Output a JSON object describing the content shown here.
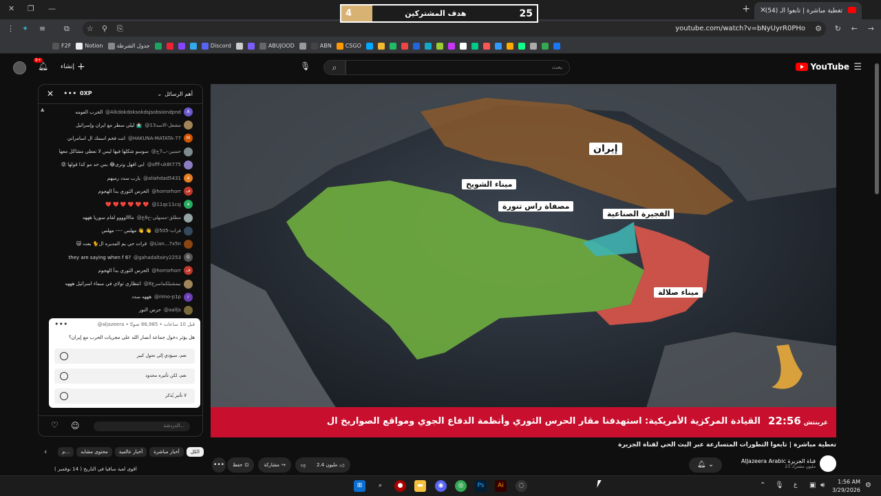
{
  "browser": {
    "tab_title": "(54) تغطية مباشرة | تابعوا الـ",
    "url": "youtube.com/watch?v=bNyUyrR0PHo",
    "bookmarks": [
      {
        "label": "F2F",
        "color": "#555"
      },
      {
        "label": "Notion",
        "color": "#eee"
      },
      {
        "label": "جدول الشرطة",
        "color": "#888"
      },
      {
        "label": "",
        "color": "#1da462"
      },
      {
        "label": "",
        "color": "#e23"
      },
      {
        "label": "",
        "color": "#8844ff"
      },
      {
        "label": "",
        "color": "#3ae"
      },
      {
        "label": "Discord",
        "color": "#5865f2"
      },
      {
        "label": "",
        "color": "#ccc"
      },
      {
        "label": "",
        "color": "#7b5cff"
      },
      {
        "label": "ABUJOOD",
        "color": "#666"
      },
      {
        "label": "",
        "color": "#999"
      },
      {
        "label": "ABN",
        "color": "#444"
      },
      {
        "label": "CSGO",
        "color": "#f90"
      },
      {
        "label": "",
        "color": "#0af"
      },
      {
        "label": "",
        "color": "#f3ba2f"
      },
      {
        "label": "",
        "color": "#2b6"
      },
      {
        "label": "",
        "color": "#e44"
      },
      {
        "label": "",
        "color": "#26d"
      },
      {
        "label": "",
        "color": "#1ac"
      },
      {
        "label": "",
        "color": "#9c3"
      },
      {
        "label": "",
        "color": "#c3f"
      },
      {
        "label": "",
        "color": "#fff"
      },
      {
        "label": "",
        "color": "#0c8"
      },
      {
        "label": "",
        "color": "#f55"
      },
      {
        "label": "",
        "color": "#39f"
      },
      {
        "label": "",
        "color": "#fa0"
      },
      {
        "label": "",
        "color": "#1f8"
      },
      {
        "label": "",
        "color": "#aaa"
      },
      {
        "label": "",
        "color": "#34a853"
      },
      {
        "label": "",
        "color": "#1877f2"
      }
    ]
  },
  "goal_overlay": {
    "label": "هدف المشتركين",
    "current": "4",
    "target": "25",
    "progress": 0.16,
    "fill_color": "#d8b272"
  },
  "youtube": {
    "logo_text": "YouTube",
    "search_placeholder": "بحث",
    "create_label": "إنشاء",
    "notification_count": "9+"
  },
  "chat": {
    "header_title": "أهم الرسائل",
    "points": "0XP",
    "messages": [
      {
        "author": "@Alkdokdoksokdsjsobsiondpnd",
        "text": "الحرب العومه",
        "avatar_color": "#6a5acd",
        "avatar_letter": "A"
      },
      {
        "author": "@مشعل-الاسد13",
        "text": "ليلي سطر مع ايران وإسرائيل 🤷🏻‍♂️",
        "avatar_color": "#a0855b",
        "avatar_letter": ""
      },
      {
        "author": "@HAKUNA-MATATA-77",
        "text": "انت فخم اسمك ال اسامراني",
        "avatar_color": "#d35400",
        "avatar_letter": "M"
      },
      {
        "author": "@حسين-ب7ح",
        "text": "سوسو شكلها فيها ليس لا نعطي مشاكل معها",
        "avatar_color": "#7f8c8d",
        "avatar_letter": ""
      },
      {
        "author": "@sfff-uk8t775",
        "text": "😟 ابي افهل وترى😂 بس حد مو كذا قولها",
        "avatar_color": "#8e7cc3",
        "avatar_letter": ""
      },
      {
        "author": "@aliahdad5431",
        "text": "يارب سدد رميهم",
        "avatar_color": "#e67e22",
        "avatar_letter": "a"
      },
      {
        "author": "@horrorhorr",
        "text": "الحرس الثوري بدأ الهجوم",
        "avatar_color": "#c0392b",
        "avatar_letter": "ف"
      },
      {
        "author": "@11qc11csj",
        "text": "❤️ ❤️ ❤️ ❤️ ❤️ ❤️",
        "avatar_color": "#27ae60",
        "avatar_letter": "a"
      },
      {
        "author": "@مطلق-مسهلي-ح8غ",
        "text": "مااااوووو لقام سوريا هههه",
        "avatar_color": "#95a5a6",
        "avatar_letter": ""
      },
      {
        "author": "@505-فرات",
        "text": "مهلس ---- مهلس 👋 👋",
        "avatar_color": "#34495e",
        "avatar_letter": ""
      },
      {
        "author": "@Lian...7x5n",
        "text": "🙀 قرات حي يم المديره ال🐈 بعت",
        "avatar_color": "#8b4513",
        "avatar_letter": ""
      },
      {
        "author": "@gahadaltairy2253",
        "text": "they are saying when f 6?",
        "avatar_color": "#555",
        "avatar_letter": "G"
      },
      {
        "author": "@horrorhorr",
        "text": "الحرس الثوري بدأ الهجوم",
        "avatar_color": "#c0392b",
        "avatar_letter": "ف"
      },
      {
        "author": "@نيمشبلكماسرع8",
        "text": "انتظاري تولاي في سماء اسرائيل هههه",
        "avatar_color": "#a0855b",
        "avatar_letter": ""
      },
      {
        "author": "@rimo-p1p",
        "text": "هههه سدد",
        "avatar_color": "#6c3fb5",
        "avatar_letter": "r"
      },
      {
        "author": "@aalljs",
        "text": "حرس النور",
        "avatar_color": "#7a6a3a",
        "avatar_letter": ""
      }
    ],
    "poll": {
      "meta": "@aljazeera • قبل 10 ساعات • 86,985 صوتًا",
      "question": "هل يؤثر دخول جماعة أنصار الله على مجريات الحرب مع إيران؟",
      "options": [
        "نعم، سيؤدي إلى تحول كبير",
        "نعم، لكن تأثيره محدود",
        "لا تأثير يُذكر"
      ]
    },
    "input_placeholder": "الدردشة..."
  },
  "chips": [
    "الكل",
    "أخبار مباشرة",
    "أخبار عالمية",
    "محتوى مشابه",
    "م..."
  ],
  "related_title": "أقوى لعبة سافيا في التاريخ ( 14 نوفمبر )",
  "video": {
    "map_labels": {
      "iran": "إيران",
      "sheikh_port": "ميناء الشويخ",
      "ras_tanura": "مصفاة راس تنورة",
      "fujairah": "الفجيرة الصناعية",
      "salalah": "ميناء صلالة"
    },
    "ticker_text": "القيادة المركزية الأمريكية: استهدفنا مقار الحرس الثوري وأنظمة الدفاع الجوي ومواقع الصواريخ ال",
    "ticker_time": "22:56",
    "ticker_tz": "غرينتش",
    "ticker_color": "#c8102e",
    "region_colors": {
      "saudi": "#6fae3e",
      "iran": "#8a5a2e",
      "oman": "#e0574a",
      "uae": "#3fb3b0"
    }
  },
  "under_video": {
    "title": "تغطية مباشرة | تابعوا التطورات المتسارعة عبر البث الحي لقناة الجزيرة",
    "channel": "AlJazeera Arabic قناة الجزيرة",
    "subscribers": "23 مليون مشترك",
    "likes": "2.4 مليون",
    "share": "مشاركة",
    "save": "حفظ"
  },
  "taskbar": {
    "time": "1:56 AM",
    "date": "3/29/2026",
    "lang": "ع"
  }
}
